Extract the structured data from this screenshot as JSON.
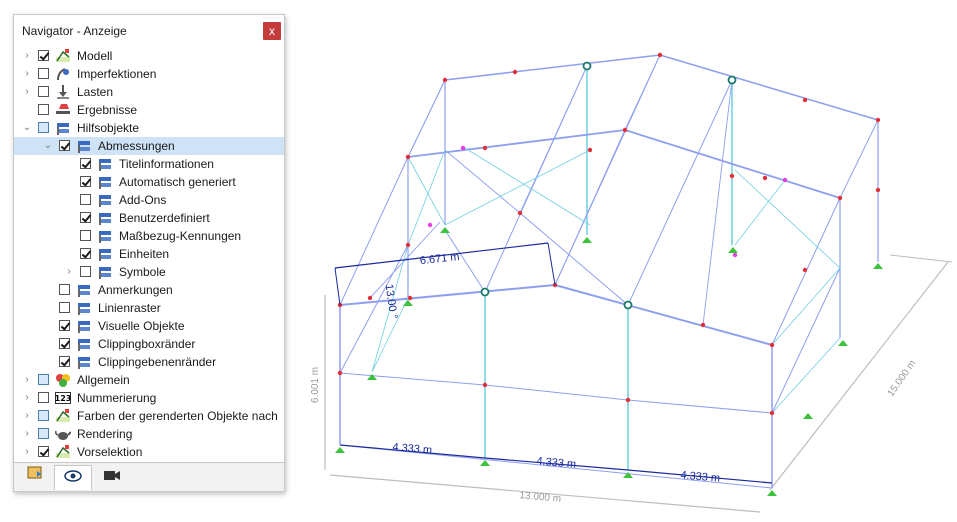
{
  "navigator": {
    "title": "Navigator - Anzeige",
    "close_label": "x",
    "items": [
      {
        "label": "Modell"
      },
      {
        "label": "Imperfektionen"
      },
      {
        "label": "Lasten"
      },
      {
        "label": "Ergebnisse"
      },
      {
        "label": "Hilfsobjekte"
      },
      {
        "label": "Abmessungen"
      },
      {
        "label": "Titelinformationen"
      },
      {
        "label": "Automatisch generiert"
      },
      {
        "label": "Add-Ons"
      },
      {
        "label": "Benutzerdefiniert"
      },
      {
        "label": "Maßbezug-Kennungen"
      },
      {
        "label": "Einheiten"
      },
      {
        "label": "Symbole"
      },
      {
        "label": "Anmerkungen"
      },
      {
        "label": "Linienraster"
      },
      {
        "label": "Visuelle Objekte"
      },
      {
        "label": "Clippingboxränder"
      },
      {
        "label": "Clippingebenenränder"
      },
      {
        "label": "Allgemein"
      },
      {
        "label": "Nummerierung"
      },
      {
        "label": "Farben der gerenderten Objekte nach"
      },
      {
        "label": "Rendering"
      },
      {
        "label": "Vorselektion"
      }
    ],
    "tabs": [
      "data-tab",
      "view-tab",
      "video-tab"
    ]
  },
  "model": {
    "dim_span_1": "4.333 m",
    "dim_span_2": "4.333 m",
    "dim_span_3": "4.333 m",
    "dim_length": "13.000 m",
    "dim_depth": "15.000 m",
    "dim_height": "6.001 m",
    "dim_roof": "6.671 m",
    "dim_angle": "13.00 °"
  },
  "colors": {
    "member": "#8e9ff0",
    "column": "#6fcfe0",
    "node": "#e0303a",
    "support": "#3cc23c",
    "dimension": "#1a2a9c"
  }
}
